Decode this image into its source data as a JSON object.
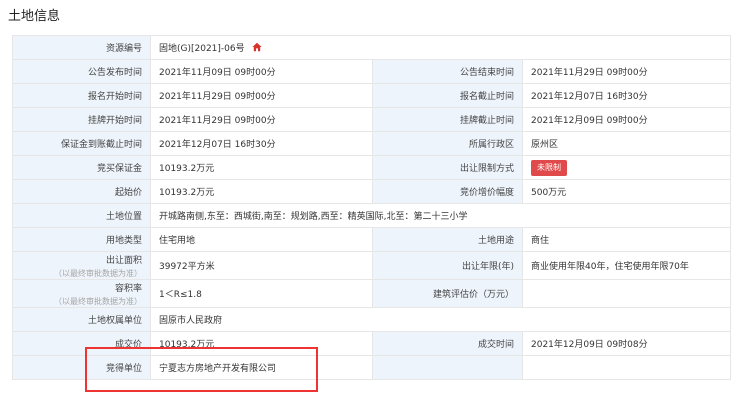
{
  "section_title": "土地信息",
  "colors": {
    "label_bg": "#eef4fb",
    "badge": "#e04a4a",
    "highlight_border": "#e33333",
    "home_icon": "#d9342b"
  },
  "icons": {
    "home": "home-icon"
  },
  "rows": {
    "r1": {
      "l1": "资源编号",
      "v1": "固地(G)[2021]-06号"
    },
    "r2": {
      "l1": "公告发布时间",
      "v1": "2021年11月09日 09时00分",
      "l2": "公告结束时间",
      "v2": "2021年11月29日 09时00分"
    },
    "r3": {
      "l1": "报名开始时间",
      "v1": "2021年11月29日 09时00分",
      "l2": "报名截止时间",
      "v2": "2021年12月07日 16时30分"
    },
    "r4": {
      "l1": "挂牌开始时间",
      "v1": "2021年11月29日 09时00分",
      "l2": "挂牌截止时间",
      "v2": "2021年12月09日 09时00分"
    },
    "r5": {
      "l1": "保证金到账截止时间",
      "v1": "2021年12月07日 16时30分",
      "l2": "所属行政区",
      "v2": "原州区"
    },
    "r6": {
      "l1": "竞买保证金",
      "v1": "10193.2万元",
      "l2": "出让限制方式",
      "v2": "未限制"
    },
    "r7": {
      "l1": "起始价",
      "v1": "10193.2万元",
      "l2": "竞价增价幅度",
      "v2": "500万元"
    },
    "r8": {
      "l1": "土地位置",
      "v1": "开城路南侧,东至：西城街,南至：规划路,西至：精英国际,北至：第二十三小学"
    },
    "r9": {
      "l1": "用地类型",
      "v1": "住宅用地",
      "l2": "土地用途",
      "v2": "商住"
    },
    "r10": {
      "l1": "出让面积",
      "l1_sub": "（以最终审批数据为准）",
      "v1": "39972平方米",
      "l2": "出让年限(年)",
      "v2": "商业使用年限40年，住宅使用年限70年"
    },
    "r11": {
      "l1": "容积率",
      "l1_sub": "（以最终审批数据为准）",
      "v1": "1＜R≤1.8",
      "l2": "建筑评估价（万元）",
      "v2": ""
    },
    "r12": {
      "l1": "土地权属单位",
      "v1": "固原市人民政府"
    },
    "r13": {
      "l1": "成交价",
      "v1": "10193.2万元",
      "l2": "成交时间",
      "v2": "2021年12月09日 09时08分"
    },
    "r14": {
      "l1": "竞得单位",
      "v1": "宁夏志方房地产开发有限公司"
    }
  }
}
